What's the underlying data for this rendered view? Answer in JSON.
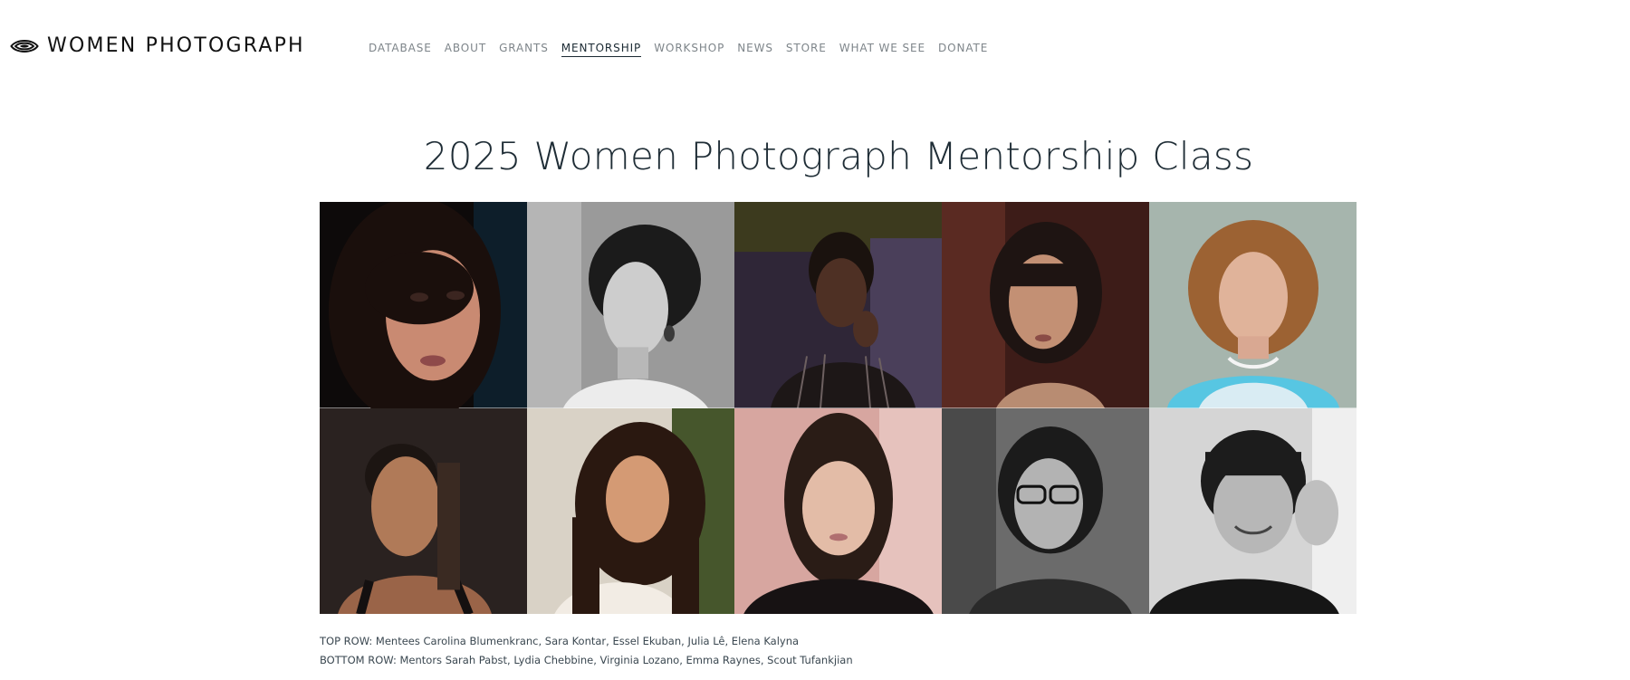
{
  "header": {
    "logo_text": "WOMEN PHOTOGRAPH",
    "logo_icon": "eye-icon",
    "nav": [
      {
        "label": "DATABASE",
        "active": false
      },
      {
        "label": "ABOUT",
        "active": false
      },
      {
        "label": "GRANTS",
        "active": false
      },
      {
        "label": "MENTORSHIP",
        "active": true
      },
      {
        "label": "WORKSHOP",
        "active": false
      },
      {
        "label": "NEWS",
        "active": false
      },
      {
        "label": "STORE",
        "active": false
      },
      {
        "label": "WHAT WE SEE",
        "active": false
      },
      {
        "label": "DONATE",
        "active": false
      }
    ]
  },
  "main": {
    "title": "2025 Women Photograph Mentorship Class",
    "photos": [
      {
        "row": "top",
        "tone": "color"
      },
      {
        "row": "top",
        "tone": "grayscale"
      },
      {
        "row": "top",
        "tone": "color"
      },
      {
        "row": "top",
        "tone": "color"
      },
      {
        "row": "top",
        "tone": "color"
      },
      {
        "row": "bottom",
        "tone": "color"
      },
      {
        "row": "bottom",
        "tone": "color"
      },
      {
        "row": "bottom",
        "tone": "color"
      },
      {
        "row": "bottom",
        "tone": "grayscale"
      },
      {
        "row": "bottom",
        "tone": "grayscale"
      }
    ],
    "caption": {
      "top_row": "TOP ROW: Mentees Carolina Blumenkranc, Sara Kontar, Essel Ekuban, Julia Lê, Elena Kalyna",
      "bottom_row": "BOTTOM ROW: Mentors Sarah Pabst, Lydia Chebbine, Virginia Lozano, Emma Raynes, Scout Tufankjian"
    }
  }
}
